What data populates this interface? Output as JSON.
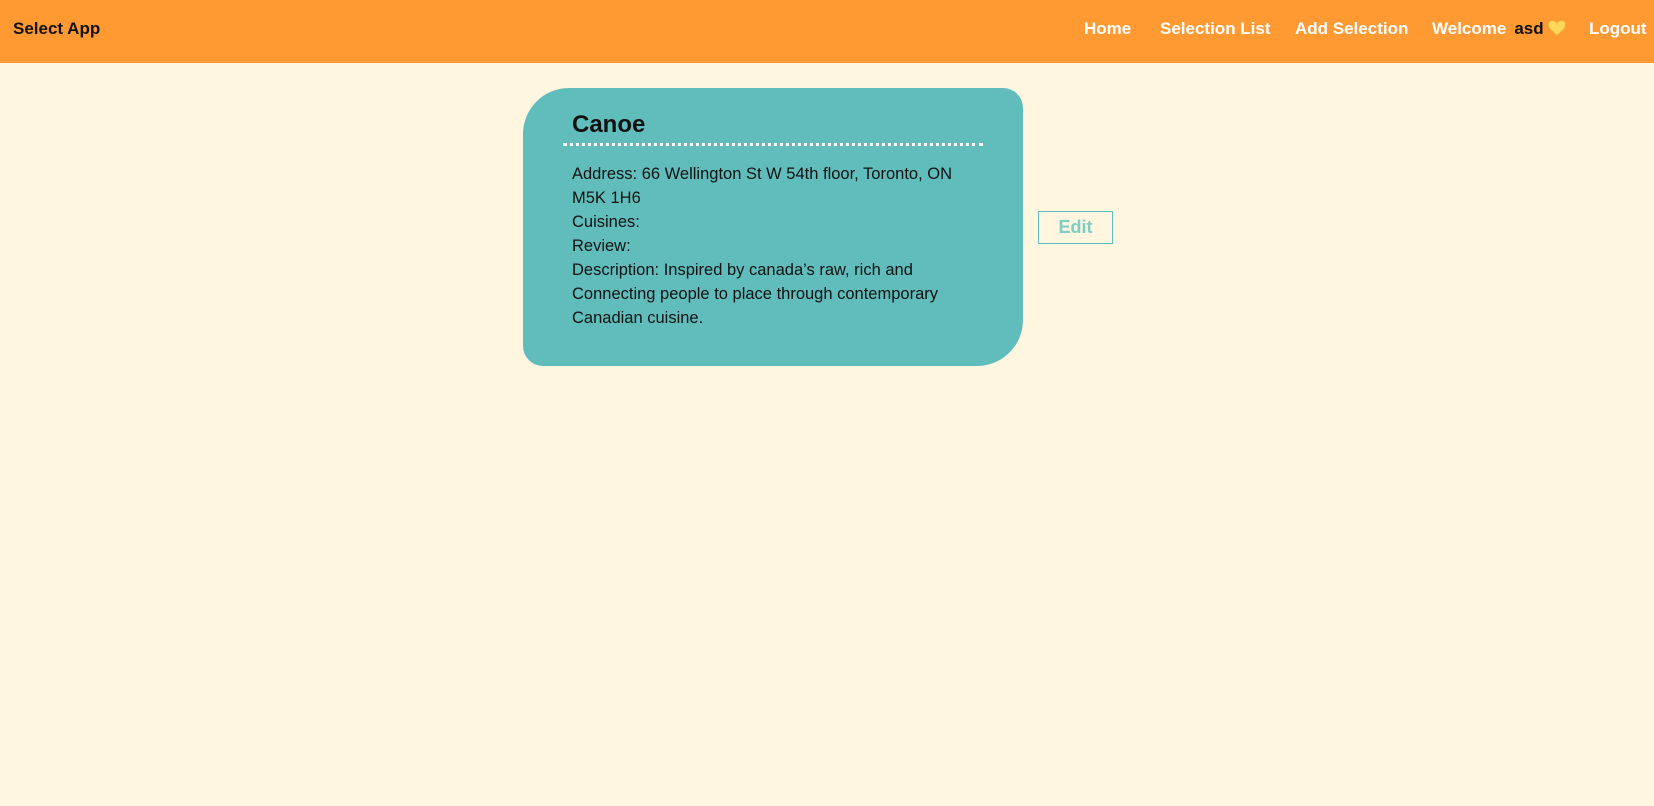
{
  "header": {
    "brand": "Select App",
    "nav": {
      "home": "Home",
      "selection_list": "Selection List",
      "add_selection": "Add Selection",
      "logout": "Logout"
    },
    "welcome": {
      "label": "Welcome",
      "username": "asd",
      "icon": "yellow-heart-icon"
    }
  },
  "selection": {
    "title": "Canoe",
    "address_line1": "Address: 66 Wellington St W 54th floor, Toronto, ON",
    "address_line2": "M5K 1H6",
    "cuisines": "Cuisines:",
    "review": "Review:",
    "description_line1": "Description: Inspired by canada’s raw, rich and",
    "description_line2": "Connecting people to place through contemporary",
    "description_line3": "Canadian cuisine."
  },
  "actions": {
    "edit_label": "Edit"
  },
  "colors": {
    "header_bg": "#ff9a33",
    "page_bg": "#fff6e0",
    "card_bg": "#60bdbb",
    "accent": "#7fcbc5"
  }
}
